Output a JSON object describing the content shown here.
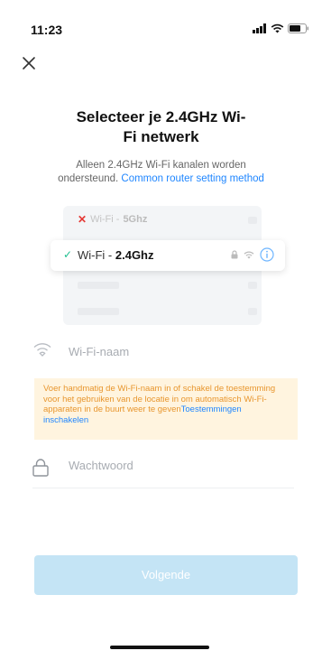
{
  "status_bar": {
    "time": "11:23"
  },
  "header": {
    "close_icon": "close-icon"
  },
  "title": {
    "line1": "Selecteer je 2.4GHz Wi-",
    "line2": "Fi netwerk"
  },
  "subtitle": {
    "text_line1": "Alleen 2.4GHz Wi-Fi kanalen worden",
    "text_line2": "ondersteund.",
    "link": "Common router setting method"
  },
  "wifi_illustration": {
    "row_5g": {
      "prefix": "Wi-Fi - ",
      "band": "5Ghz"
    },
    "row_24": {
      "prefix": "Wi-Fi - ",
      "band": "2.4Ghz"
    }
  },
  "wifi_name_field": {
    "placeholder": "Wi-Fi-naam"
  },
  "warning": {
    "text": "Voer handmatig de Wi-Fi-naam in of schakel de toestemming voor het gebruiken van de locatie in om automatisch Wi-Fi-apparaten in de buurt weer te geven",
    "link": "Toestemmingen inschakelen"
  },
  "password_field": {
    "placeholder": "Wachtwoord"
  },
  "next_button": {
    "label": "Volgende"
  },
  "colors": {
    "accent": "#1f86ff",
    "button_disabled": "#c4e4f5",
    "warning_bg": "#fff4df",
    "warning_text": "#e8962e"
  }
}
